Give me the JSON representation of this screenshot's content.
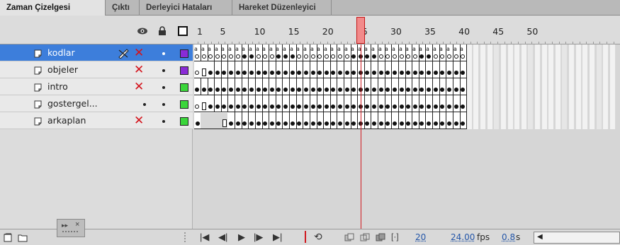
{
  "tabs": [
    {
      "label": "Zaman Çizelgesi",
      "active": true
    },
    {
      "label": "Çıktı",
      "active": false
    },
    {
      "label": "Derleyici Hataları",
      "active": false
    },
    {
      "label": "Hareket Düzenleyici",
      "active": false
    }
  ],
  "header": {
    "icons": [
      "eye-icon",
      "lock-icon",
      "outline-square-icon"
    ],
    "frame_numbers": [
      "1",
      "5",
      "10",
      "15",
      "20",
      "25",
      "30",
      "35",
      "40",
      "45",
      "50"
    ]
  },
  "playhead": {
    "frame": 20
  },
  "layers": [
    {
      "name": "kodlar",
      "selected": true,
      "color": "#8a2bd6"
    },
    {
      "name": "objeler",
      "selected": false,
      "color": "#8a2bd6"
    },
    {
      "name": "intro",
      "selected": false,
      "color": "#3ad63a"
    },
    {
      "name": "gostergel...",
      "selected": false,
      "color": "#3ad63a"
    },
    {
      "name": "arkaplan",
      "selected": false,
      "color": "#3ad63a"
    }
  ],
  "bottom": {
    "current_frame": "20",
    "fps": "24.00",
    "fps_unit": "fps",
    "time": "0.8",
    "time_unit": "s"
  },
  "colors": {
    "selection": "#3d7edb",
    "playhead": "#d0191f",
    "error_x": "#d4141c"
  }
}
